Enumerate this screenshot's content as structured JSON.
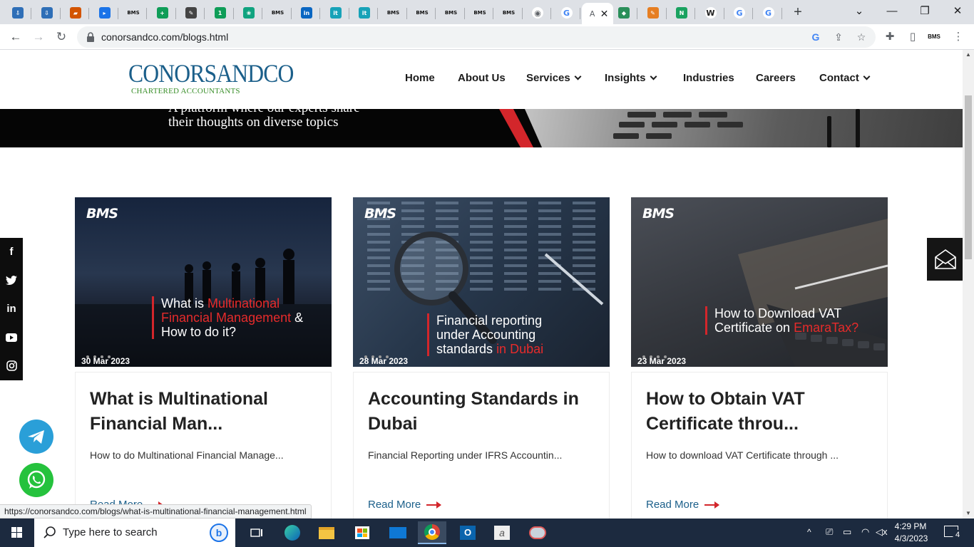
{
  "browser": {
    "tabs": [
      {
        "icon": "cloud-download-icon",
        "color": "#2f6fb7"
      },
      {
        "icon": "cloud-download-icon",
        "color": "#2f6fb7"
      },
      {
        "icon": "flag-icon",
        "color": "#d35400"
      },
      {
        "icon": "arrow-square-icon",
        "color": "#1a73e8"
      },
      {
        "icon": "bms-icon",
        "color": "#111111"
      },
      {
        "icon": "plus-square-icon",
        "color": "#0f9d58"
      },
      {
        "icon": "pen-icon",
        "color": "#444444"
      },
      {
        "icon": "number-one-icon",
        "color": "#0f9d58"
      },
      {
        "icon": "openai-icon",
        "color": "#10a37f"
      },
      {
        "icon": "bms-icon",
        "color": "#111111"
      },
      {
        "icon": "linkedin-icon",
        "color": "#0a66c2"
      },
      {
        "icon": "it-icon",
        "color": "#17a2b8"
      },
      {
        "icon": "it-icon",
        "color": "#17a2b8"
      },
      {
        "icon": "bms-icon",
        "color": "#111111"
      },
      {
        "icon": "bms-icon",
        "color": "#111111"
      },
      {
        "icon": "bms-icon",
        "color": "#111111"
      },
      {
        "icon": "bms-icon",
        "color": "#111111"
      },
      {
        "icon": "bms-icon",
        "color": "#111111"
      },
      {
        "icon": "globe-icon",
        "color": "#5f6368"
      },
      {
        "icon": "google-icon",
        "color": "#4285f4"
      }
    ],
    "tabs_after_active": [
      {
        "icon": "shield-icon",
        "color": "#2a8f5a"
      },
      {
        "icon": "pencil-icon",
        "color": "#e67e22"
      },
      {
        "icon": "n-icon",
        "color": "#1aa260"
      },
      {
        "icon": "w-icon",
        "color": "#222222"
      },
      {
        "icon": "google-icon",
        "color": "#4285f4"
      },
      {
        "icon": "google-icon",
        "color": "#4285f4"
      }
    ],
    "active_tab_label": "A",
    "url": "conorsandco.com/blogs.html",
    "status_url": "https://conorsandco.com/blogs/what-is-multinational-financial-management.html"
  },
  "site": {
    "logo_main": "CONORSANDCO",
    "logo_sub": "CHARTERED ACCOUNTANTS",
    "nav": [
      {
        "label": "Home",
        "dropdown": false
      },
      {
        "label": "About Us",
        "dropdown": false
      },
      {
        "label": "Services",
        "dropdown": true
      },
      {
        "label": "Insights",
        "dropdown": true
      },
      {
        "label": "Industries",
        "dropdown": false
      },
      {
        "label": "Careers",
        "dropdown": false
      },
      {
        "label": "Contact",
        "dropdown": true
      }
    ],
    "hero_line1": "A platform where our experts share",
    "hero_line2": "their thoughts on diverse topics",
    "accent_color": "#d3262b",
    "brand_color": "#1b5f8a"
  },
  "cards": [
    {
      "image_logo": "BMS",
      "image_title_pre": "What is ",
      "image_title_red": "Multinational Financial Management",
      "image_title_post": " & How to do it?",
      "date": "30 Mar 2023",
      "title": "What is Multinational Financial Man...",
      "excerpt": "How to do Multinational Financial Manage...",
      "read_more": "Read More"
    },
    {
      "image_logo": "BMS",
      "image_title_pre": "Financial reporting under Accounting standards ",
      "image_title_red": "in Dubai",
      "image_title_post": "",
      "date": "28 Mar 2023",
      "title": "Accounting Standards in Dubai",
      "excerpt": "Financial Reporting under IFRS Accountin...",
      "read_more": "Read More"
    },
    {
      "image_logo": "BMS",
      "image_title_pre": "How to Download VAT Certificate on ",
      "image_title_red": "EmaraTax?",
      "image_title_post": "",
      "date": "23 Mar 2023",
      "title": "How to Obtain VAT Certificate throu...",
      "excerpt": "How to download VAT Certificate through ...",
      "read_more": "Read More"
    }
  ],
  "social": [
    "facebook-icon",
    "twitter-icon",
    "linkedin-icon",
    "youtube-icon",
    "instagram-icon"
  ],
  "taskbar": {
    "search_placeholder": "Type here to search",
    "time": "4:29 PM",
    "date": "4/3/2023",
    "notification_count": "4"
  }
}
